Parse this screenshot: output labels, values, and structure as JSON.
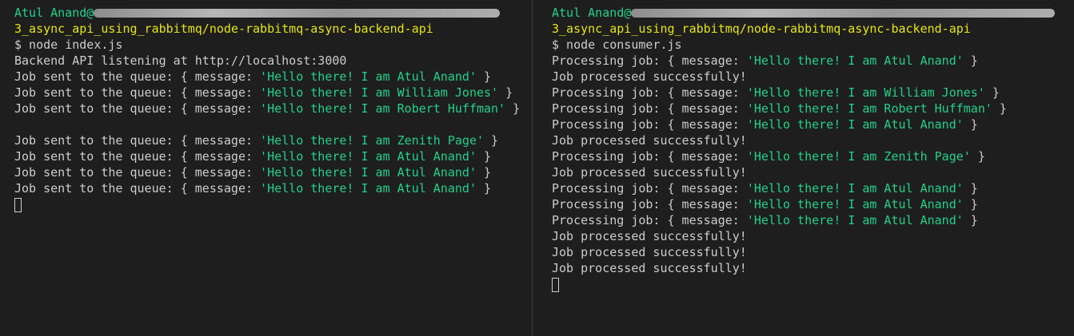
{
  "panes": {
    "producer": {
      "user": "Atul Anand@",
      "path": "3_async_api_using_rabbitmq/node-rabbitmq-async-backend-api",
      "command": "$ node index.js",
      "listening": "Backend API listening at http://localhost:3000",
      "jobs_group1": [
        {
          "prefix": "Job sent to the queue: { message: ",
          "value": "'Hello there! I am Atul Anand'",
          "suffix": " }"
        },
        {
          "prefix": "Job sent to the queue: { message: ",
          "value": "'Hello there! I am William Jones'",
          "suffix": " }"
        },
        {
          "prefix": "Job sent to the queue: { message: ",
          "value": "'Hello there! I am Robert Huffman'",
          "suffix": " }"
        }
      ],
      "jobs_group2": [
        {
          "prefix": "Job sent to the queue: { message: ",
          "value": "'Hello there! I am Zenith Page'",
          "suffix": " }"
        },
        {
          "prefix": "Job sent to the queue: { message: ",
          "value": "'Hello there! I am Atul Anand'",
          "suffix": " }"
        },
        {
          "prefix": "Job sent to the queue: { message: ",
          "value": "'Hello there! I am Atul Anand'",
          "suffix": " }"
        },
        {
          "prefix": "Job sent to the queue: { message: ",
          "value": "'Hello there! I am Atul Anand'",
          "suffix": " }"
        }
      ]
    },
    "consumer": {
      "user": "Atul Anand@",
      "path": "3_async_api_using_rabbitmq/node-rabbitmq-async-backend-api",
      "command": "$ node consumer.js",
      "log": [
        {
          "type": "processing",
          "prefix": "Processing job: { message: ",
          "value": "'Hello there! I am Atul Anand'",
          "suffix": " }"
        },
        {
          "type": "done",
          "text": "Job processed successfully!"
        },
        {
          "type": "processing",
          "prefix": "Processing job: { message: ",
          "value": "'Hello there! I am William Jones'",
          "suffix": " }"
        },
        {
          "type": "processing",
          "prefix": "Processing job: { message: ",
          "value": "'Hello there! I am Robert Huffman'",
          "suffix": " }"
        },
        {
          "type": "processing",
          "prefix": "Processing job: { message: ",
          "value": "'Hello there! I am Atul Anand'",
          "suffix": " }"
        },
        {
          "type": "done",
          "text": "Job processed successfully!"
        },
        {
          "type": "processing",
          "prefix": "Processing job: { message: ",
          "value": "'Hello there! I am Zenith Page'",
          "suffix": " }"
        },
        {
          "type": "done",
          "text": "Job processed successfully!"
        },
        {
          "type": "processing",
          "prefix": "Processing job: { message: ",
          "value": "'Hello there! I am Atul Anand'",
          "suffix": " }"
        },
        {
          "type": "processing",
          "prefix": "Processing job: { message: ",
          "value": "'Hello there! I am Atul Anand'",
          "suffix": " }"
        },
        {
          "type": "processing",
          "prefix": "Processing job: { message: ",
          "value": "'Hello there! I am Atul Anand'",
          "suffix": " }"
        },
        {
          "type": "done",
          "text": "Job processed successfully!"
        },
        {
          "type": "done",
          "text": "Job processed successfully!"
        },
        {
          "type": "done",
          "text": "Job processed successfully!"
        }
      ]
    }
  },
  "colors": {
    "background": "#1e1e1e",
    "text": "#cccccc",
    "prompt_user": "#23d18b",
    "path": "#e5e510",
    "string": "#23d18b"
  }
}
